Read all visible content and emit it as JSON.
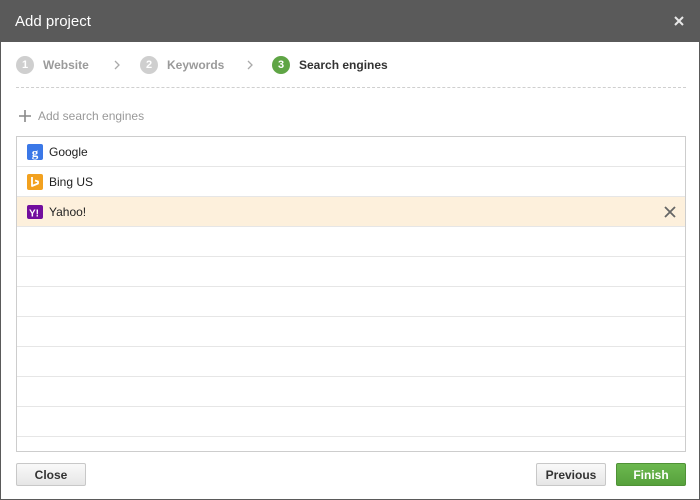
{
  "dialog": {
    "title": "Add project"
  },
  "steps": [
    {
      "number": "1",
      "label": "Website",
      "state": "done"
    },
    {
      "number": "2",
      "label": "Keywords",
      "state": "done"
    },
    {
      "number": "3",
      "label": "Search engines",
      "state": "active"
    }
  ],
  "add_link": {
    "label": "Add search engines",
    "icon": "plus-icon"
  },
  "engines": [
    {
      "name": "Google",
      "icon": "google-icon",
      "selected": false
    },
    {
      "name": "Bing US",
      "icon": "bing-icon",
      "selected": false
    },
    {
      "name": "Yahoo!",
      "icon": "yahoo-icon",
      "selected": true
    }
  ],
  "buttons": {
    "close": "Close",
    "previous": "Previous",
    "finish": "Finish"
  },
  "colors": {
    "titlebar": "#5a5a5a",
    "active_step": "#5fa545",
    "selected_row": "#fdf0dc",
    "finish": "#5fa545"
  }
}
